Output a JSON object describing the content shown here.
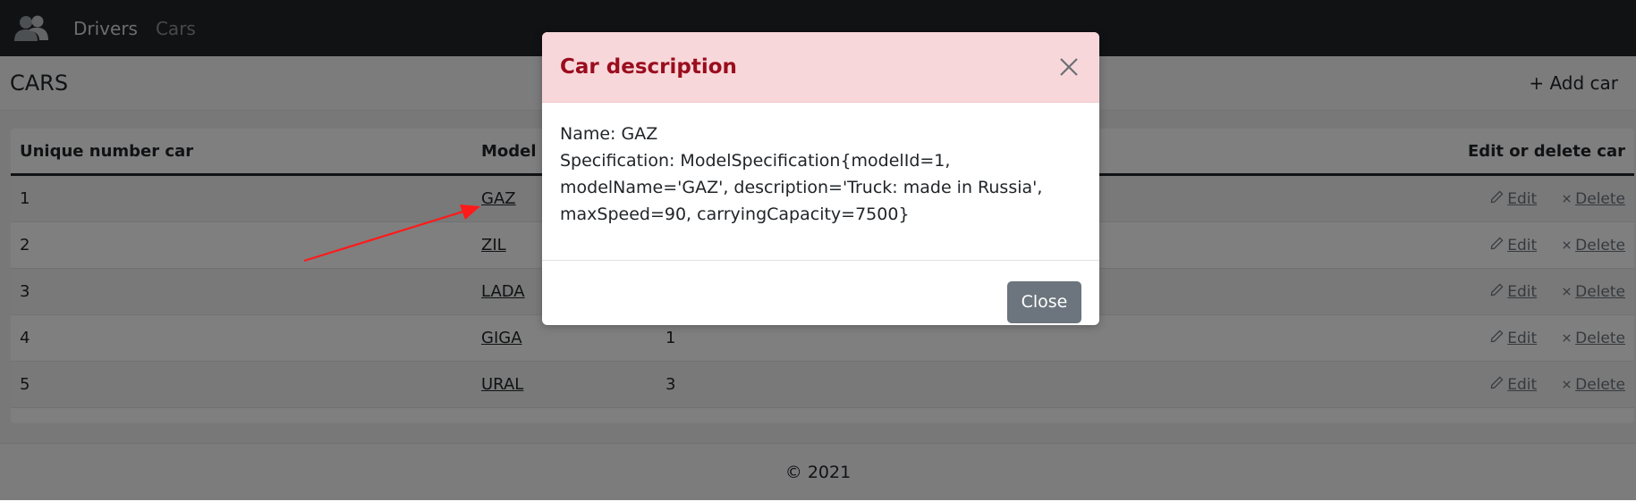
{
  "nav": {
    "drivers": "Drivers",
    "cars": "Cars"
  },
  "page": {
    "title": "CARS",
    "add_car": "+ Add car"
  },
  "table": {
    "headers": {
      "number": "Unique number car",
      "model": "Model",
      "actions": "Edit or delete car"
    },
    "rows": [
      {
        "number": "1",
        "model": "GAZ",
        "extra": ""
      },
      {
        "number": "2",
        "model": "ZIL",
        "extra": ""
      },
      {
        "number": "3",
        "model": "LADA",
        "extra": ""
      },
      {
        "number": "4",
        "model": "GIGA",
        "extra": "1"
      },
      {
        "number": "5",
        "model": "URAL",
        "extra": "3"
      }
    ],
    "edit_label": "Edit",
    "delete_label": "Delete"
  },
  "footer": {
    "text": "© 2021"
  },
  "modal": {
    "title": "Car description",
    "name_line": "Name: GAZ",
    "spec_lines": [
      "Specification: ModelSpecification{modelId=1,",
      "modelName='GAZ', description='Truck: made in Russia',",
      "maxSpeed=90, carryingCapacity=7500}"
    ],
    "close_button": "Close"
  },
  "icons": {
    "brand": "users-icon",
    "edit": "pencil-icon",
    "delete": "times-icon",
    "close": "close-icon",
    "annotation": "red-arrow"
  },
  "colors": {
    "modal_header_bg": "#f8d7da",
    "modal_title": "#9a0d1e",
    "annotation_arrow": "#ff1a1a"
  }
}
